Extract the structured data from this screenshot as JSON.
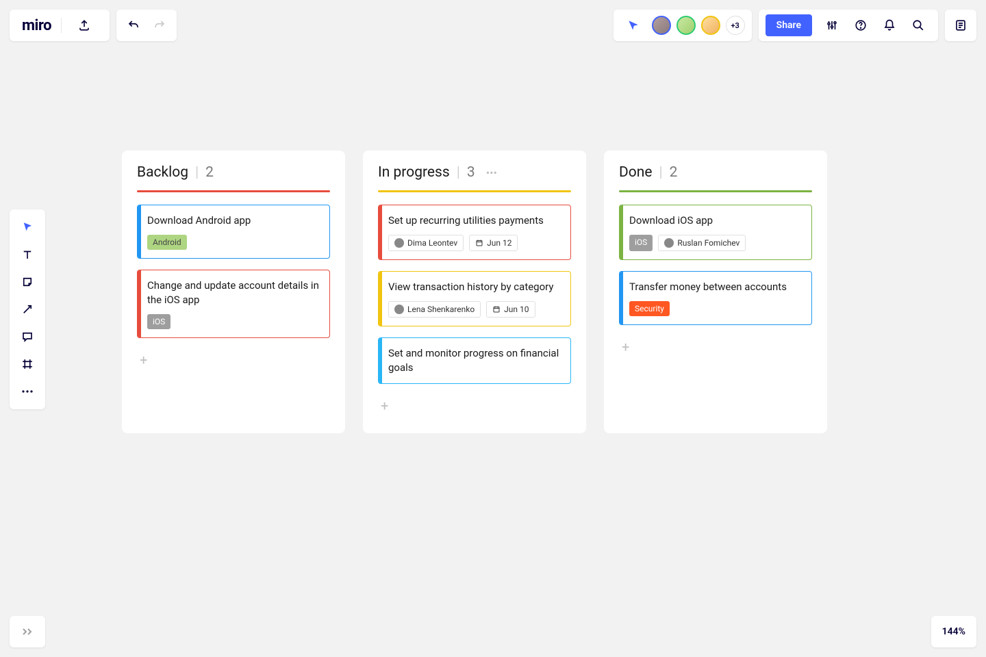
{
  "app_name": "miro",
  "presence": {
    "extra_count": "+3"
  },
  "share_label": "Share",
  "zoom_level": "144%",
  "columns": [
    {
      "title": "Backlog",
      "count": "2",
      "rule_color": "red",
      "cards": [
        {
          "title": "Download Android app",
          "stripe": "blue",
          "tags": [
            {
              "text": "Android",
              "class": "tag-android"
            }
          ]
        },
        {
          "title": "Change and update account details in the iOS app",
          "stripe": "red",
          "tags": [
            {
              "text": "iOS",
              "class": "tag-ios"
            }
          ]
        }
      ]
    },
    {
      "title": "In progress",
      "count": "3",
      "rule_color": "yellow",
      "show_dots": true,
      "cards": [
        {
          "title": "Set up recurring utilities payments",
          "stripe": "red",
          "assignee": "Dima Leontev",
          "date": "Jun 12"
        },
        {
          "title": "View transaction history by category",
          "stripe": "yellow",
          "assignee": "Lena Shenkarenko",
          "date": "Jun 10"
        },
        {
          "title": "Set and monitor progress on financial goals",
          "stripe": "cyan"
        }
      ]
    },
    {
      "title": "Done",
      "count": "2",
      "rule_color": "green",
      "cards": [
        {
          "title": "Download iOS app",
          "stripe": "green",
          "tags": [
            {
              "text": "iOS",
              "class": "tag-ios"
            }
          ],
          "assignee": "Ruslan Fomichev"
        },
        {
          "title": "Transfer money between accounts",
          "stripe": "blue",
          "tags": [
            {
              "text": "Security",
              "class": "tag-security"
            }
          ]
        }
      ]
    }
  ]
}
